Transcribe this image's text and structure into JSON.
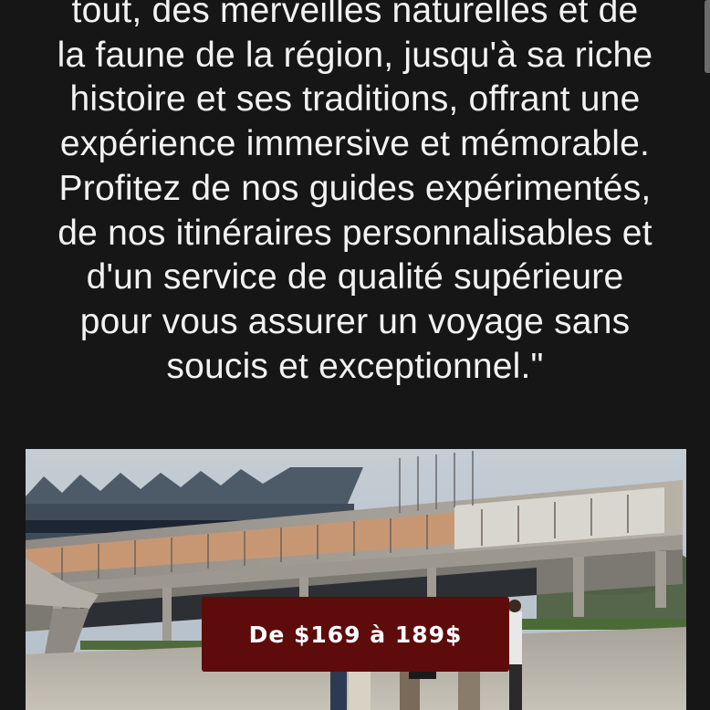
{
  "description": {
    "lines": [
      "tout, des merveilles naturelles et de",
      "la faune de la région, jusqu'à sa riche",
      "histoire et ses traditions, offrant une",
      "expérience immersive et mémorable.",
      "Profitez de nos guides expérimentés,",
      "de nos itinéraires personnalisables et",
      "d'un service de qualité supérieure",
      "pour vous assurer un voyage sans",
      "soucis et exceptionnel.\""
    ]
  },
  "price_badge": {
    "label": "De $169 à 189$",
    "background": "#5e0b0b"
  },
  "colors": {
    "page_background": "#161616",
    "text": "#f2f2f2"
  }
}
